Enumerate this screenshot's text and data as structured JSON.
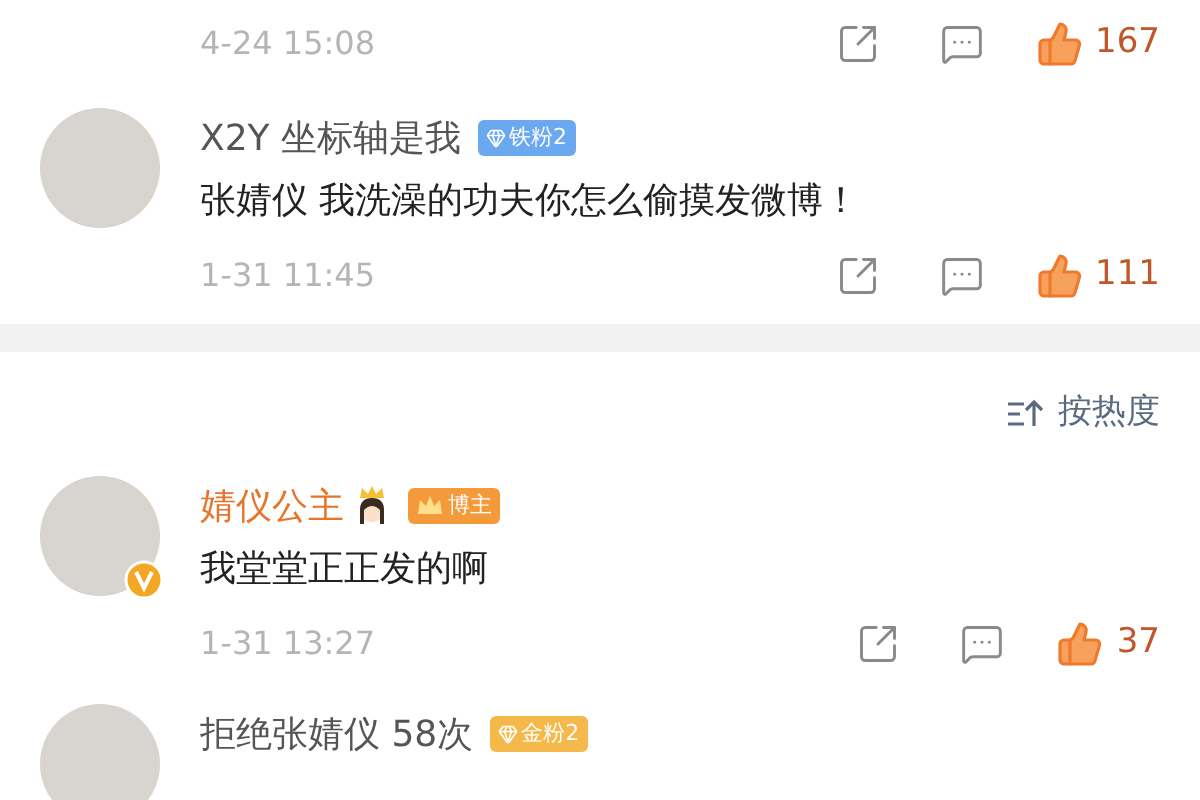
{
  "top_comment": {
    "time": "4-24 15:08",
    "liked": true,
    "likes": "167"
  },
  "first_comments": [
    {
      "user": "X2Y 坐标轴是我",
      "name_highlight": false,
      "verified": false,
      "crown": false,
      "badge": {
        "kind": "iron-fan",
        "text": "铁粉2"
      },
      "text": "张婧仪 我洗澡的功夫你怎么偷摸发微博！",
      "time": "1-31 11:45",
      "liked": true,
      "likes": "111"
    }
  ],
  "sort_button": {
    "label": "按热度"
  },
  "comments": [
    {
      "user": "婧仪公主",
      "name_highlight": true,
      "verified": true,
      "crown": true,
      "badge": {
        "kind": "blogger",
        "text": "博主"
      },
      "text": "我堂堂正正发的啊",
      "time": "1-31 13:27",
      "liked": true,
      "likes": "37"
    },
    {
      "user": "拒绝张婧仪 58次",
      "name_highlight": false,
      "verified": false,
      "crown": false,
      "badge": {
        "kind": "gold-fan",
        "text": "金粉2"
      }
    }
  ]
}
